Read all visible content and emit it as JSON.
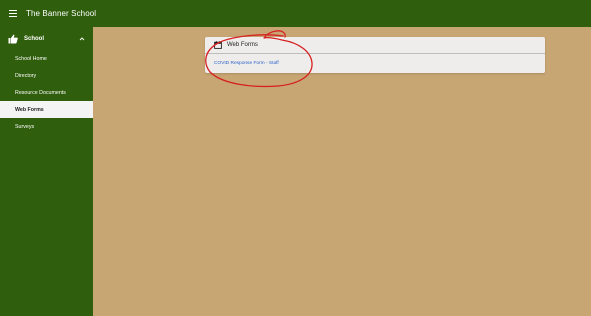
{
  "header": {
    "menu_icon": "hamburger-menu-icon",
    "title": "The Banner School"
  },
  "sidebar": {
    "section": {
      "label": "School",
      "icon": "thumbs-up-icon",
      "expanded": true
    },
    "items": [
      {
        "label": "School Home",
        "active": false
      },
      {
        "label": "Directory",
        "active": false
      },
      {
        "label": "Resource Documents",
        "active": false
      },
      {
        "label": "Web Forms",
        "active": true
      },
      {
        "label": "Surveys",
        "active": false
      }
    ]
  },
  "main": {
    "card": {
      "title": "Web Forms",
      "icon": "calendar-icon",
      "links": [
        "COVID Response Form - Staff"
      ]
    }
  },
  "colors": {
    "brand_green": "#2f5e0c",
    "content_bg": "#c8a674",
    "link_blue": "#2a62c9",
    "annotation_red": "#d62020"
  }
}
